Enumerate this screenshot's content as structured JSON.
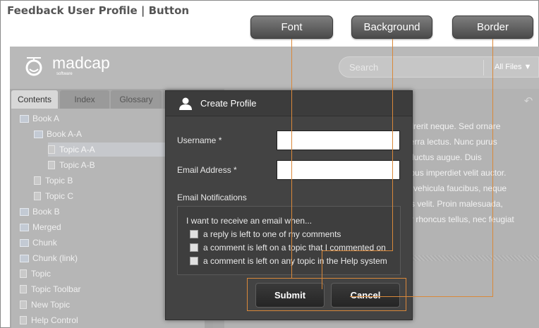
{
  "doc": {
    "title": "Feedback User Profile | Button"
  },
  "callouts": {
    "font": "Font",
    "background": "Background",
    "border": "Border"
  },
  "header": {
    "logo_text": "madcap",
    "logo_sub": "software",
    "search_placeholder": "Search",
    "search_filter": "All Files ▼"
  },
  "tabs": [
    {
      "label": "Contents"
    },
    {
      "label": "Index"
    },
    {
      "label": "Glossary"
    }
  ],
  "tree": [
    {
      "label": "Book A",
      "icon": "book-icon"
    },
    {
      "label": "Book A-A",
      "icon": "book-icon"
    },
    {
      "label": "Topic A-A",
      "icon": "page-icon"
    },
    {
      "label": "Topic A-B",
      "icon": "page-icon"
    },
    {
      "label": "Topic B",
      "icon": "page-icon"
    },
    {
      "label": "Topic C",
      "icon": "page-icon"
    },
    {
      "label": "Book B",
      "icon": "book-icon"
    },
    {
      "label": "Merged",
      "icon": "book-icon"
    },
    {
      "label": "Chunk",
      "icon": "book-icon"
    },
    {
      "label": "Chunk (link)",
      "icon": "book-icon"
    },
    {
      "label": "Topic",
      "icon": "page-icon"
    },
    {
      "label": "Topic Toolbar",
      "icon": "page-icon"
    },
    {
      "label": "New Topic",
      "icon": "page-icon"
    },
    {
      "label": "Help Control",
      "icon": "page-icon"
    }
  ],
  "content_lines": [
    "endrerit neque. Sed ornare",
    "viverra lectus. Nunc purus",
    "illa luctus augue. Duis",
    "ucibus imperdiet velit auctor.",
    "tae vehicula faucibus, neque",
    "quis velit. Proin malesuada,",
    "olor rhoncus tellus, nec feugiat"
  ],
  "dialog": {
    "title": "Create Profile",
    "username_label": "Username *",
    "username_value": "",
    "email_label": "Email Address *",
    "email_value": "",
    "notifications_label": "Email Notifications",
    "notif_intro": "I want to receive an email when...",
    "options": [
      "a reply is left to one of my comments",
      "a comment is left on a topic that I commented on",
      "a comment is left on any topic in the Help system"
    ],
    "submit": "Submit",
    "cancel": "Cancel"
  },
  "colors": {
    "callout_line": "#d9883a",
    "dialog_bg": "#434343"
  }
}
